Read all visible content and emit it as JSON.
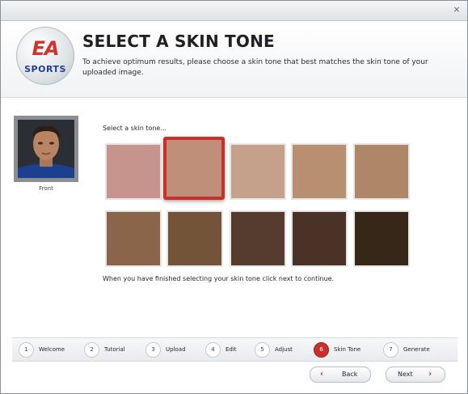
{
  "window": {
    "close_glyph": "×"
  },
  "header": {
    "logo_top": "EA",
    "logo_bottom": "SPORTS",
    "title": "SELECT A SKIN TONE",
    "description": "To achieve optimum results, please choose a skin tone that best matches the skin tone of your uploaded image."
  },
  "photo": {
    "caption": "Front"
  },
  "skin": {
    "prompt": "Select a skin tone...",
    "selected_index": 1,
    "tones": [
      "#c7948d",
      "#c08f79",
      "#c5a08a",
      "#b88f71",
      "#ad8768",
      "#8b6549",
      "#745438",
      "#563c2e",
      "#4a3227",
      "#372719"
    ],
    "finish_note": "When you have finished selecting your skin tone click next to continue."
  },
  "steps": [
    {
      "num": "1",
      "label": "Welcome"
    },
    {
      "num": "2",
      "label": "Tutorial"
    },
    {
      "num": "3",
      "label": "Upload"
    },
    {
      "num": "4",
      "label": "Edit"
    },
    {
      "num": "5",
      "label": "Adjust"
    },
    {
      "num": "6",
      "label": "Skin Tone",
      "active": true
    },
    {
      "num": "7",
      "label": "Generate"
    }
  ],
  "nav": {
    "back_label": "Back",
    "next_label": "Next"
  },
  "colors": {
    "accent": "#c9302c",
    "logo_red": "#d0342c",
    "logo_blue": "#213f99"
  }
}
